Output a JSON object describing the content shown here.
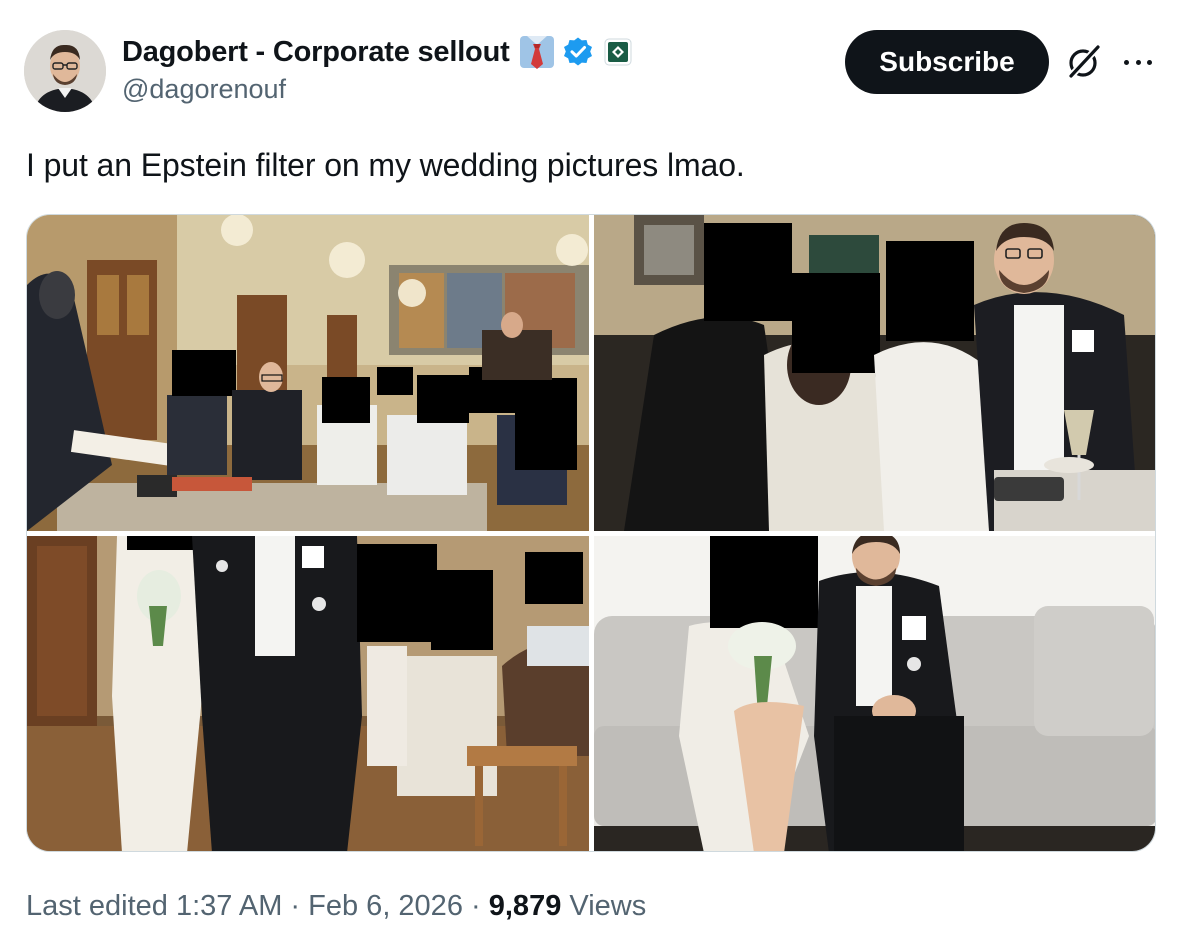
{
  "author": {
    "display_name": "Dagobert - Corporate sellout",
    "handle": "@dagorenouf",
    "name_emoji": "necktie-emoji",
    "verified_icon": "verified-badge-icon",
    "affiliate_icon": "affiliate-badge-icon"
  },
  "actions": {
    "subscribe_label": "Subscribe",
    "grok_icon": "grok-icon",
    "more_icon": "more-icon"
  },
  "tweet": {
    "text": "I put an Epstein filter on my wedding pictures lmao."
  },
  "media": {
    "count": 4
  },
  "meta": {
    "edited_prefix": "Last edited",
    "time": "1:37 AM",
    "separator": "·",
    "date": "Feb 6, 2026",
    "views_count": "9,879",
    "views_label": "Views"
  },
  "colors": {
    "text_primary": "#0f1419",
    "text_secondary": "#536471",
    "verified_blue": "#1d9bf0",
    "button_bg": "#0f1419",
    "border": "#cfd9de"
  }
}
